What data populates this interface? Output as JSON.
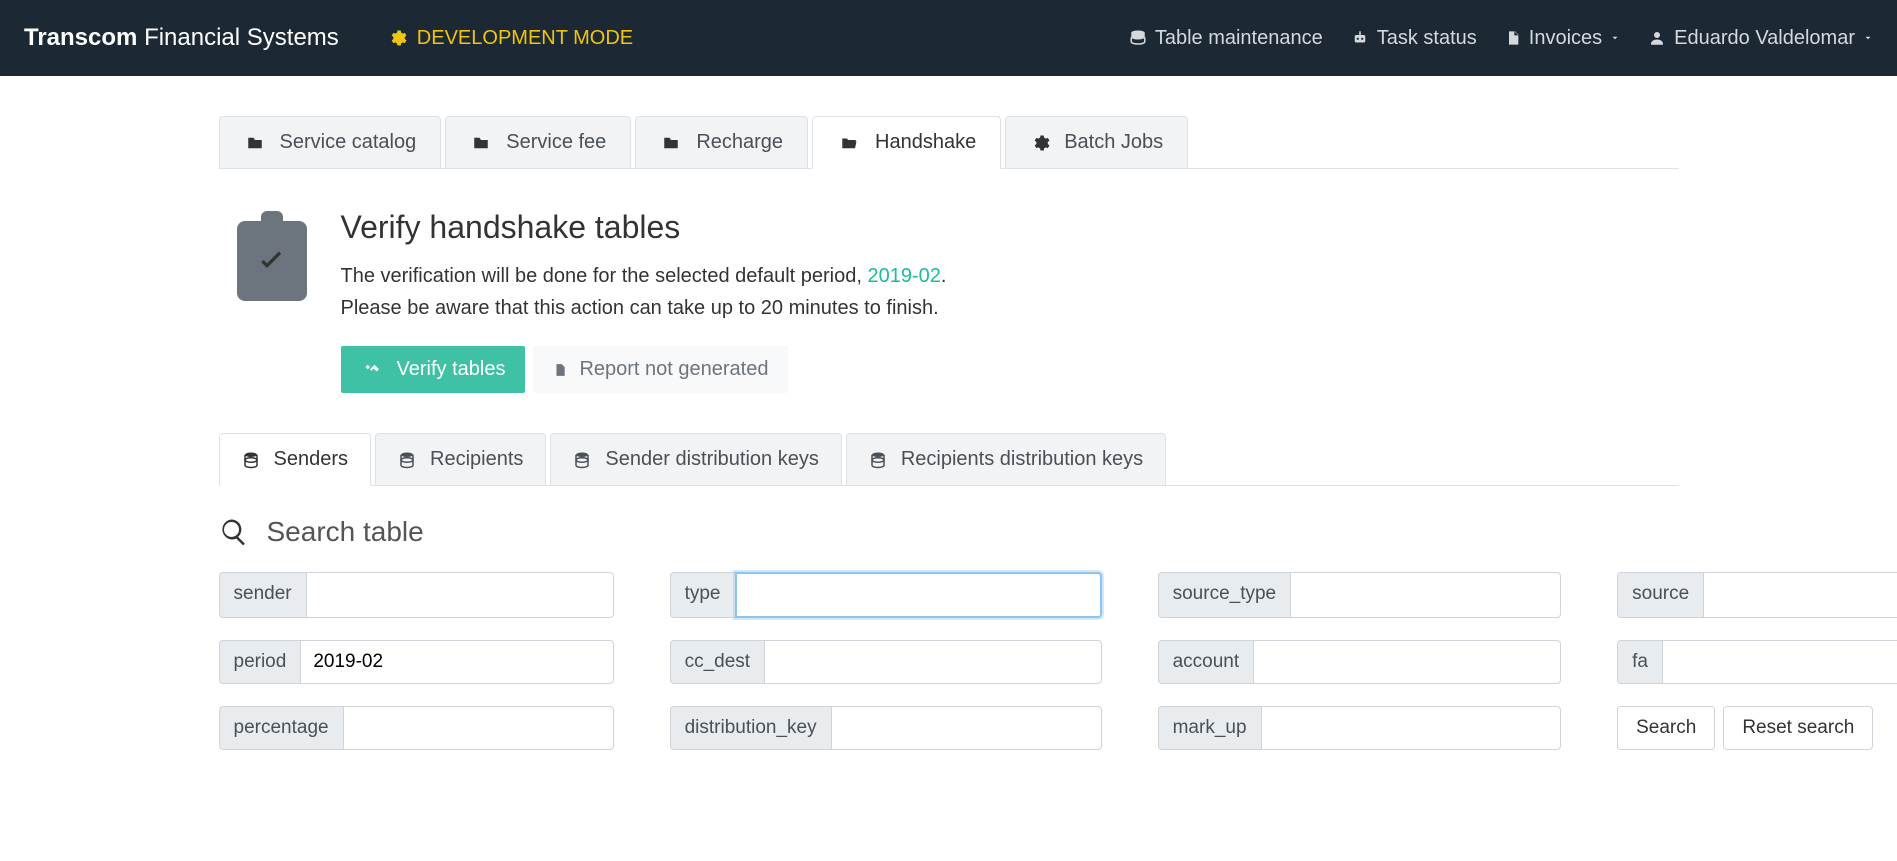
{
  "brand": {
    "bold": "Transcom",
    "light": "Financial Systems"
  },
  "dev_mode": "DEVELOPMENT MODE",
  "nav": {
    "table_maintenance": "Table maintenance",
    "task_status": "Task status",
    "invoices": "Invoices",
    "user": "Eduardo Valdelomar"
  },
  "main_tabs": {
    "service_catalog": "Service catalog",
    "service_fee": "Service fee",
    "recharge": "Recharge",
    "handshake": "Handshake",
    "batch_jobs": "Batch Jobs"
  },
  "header": {
    "title": "Verify handshake tables",
    "line1_pre": "The verification will be done for the selected default period, ",
    "period": "2019-02",
    "line1_post": ".",
    "line2": "Please be aware that this action can take up to 20 minutes to finish.",
    "verify_btn": "Verify tables",
    "report_btn": "Report not generated"
  },
  "sub_tabs": {
    "senders": "Senders",
    "recipients": "Recipients",
    "sender_dist": "Sender distribution keys",
    "recipient_dist": "Recipients distribution keys"
  },
  "search": {
    "title": "Search table",
    "fields": {
      "sender": "sender",
      "type": "type",
      "source_type": "source_type",
      "source": "source",
      "period": "period",
      "cc_dest": "cc_dest",
      "account": "account",
      "fa": "fa",
      "percentage": "percentage",
      "distribution_key": "distribution_key",
      "mark_up": "mark_up"
    },
    "values": {
      "sender": "",
      "type": "",
      "source_type": "",
      "source": "",
      "period": "2019-02",
      "cc_dest": "",
      "account": "",
      "fa": "",
      "percentage": "",
      "distribution_key": "",
      "mark_up": ""
    },
    "search_btn": "Search",
    "reset_btn": "Reset search"
  }
}
